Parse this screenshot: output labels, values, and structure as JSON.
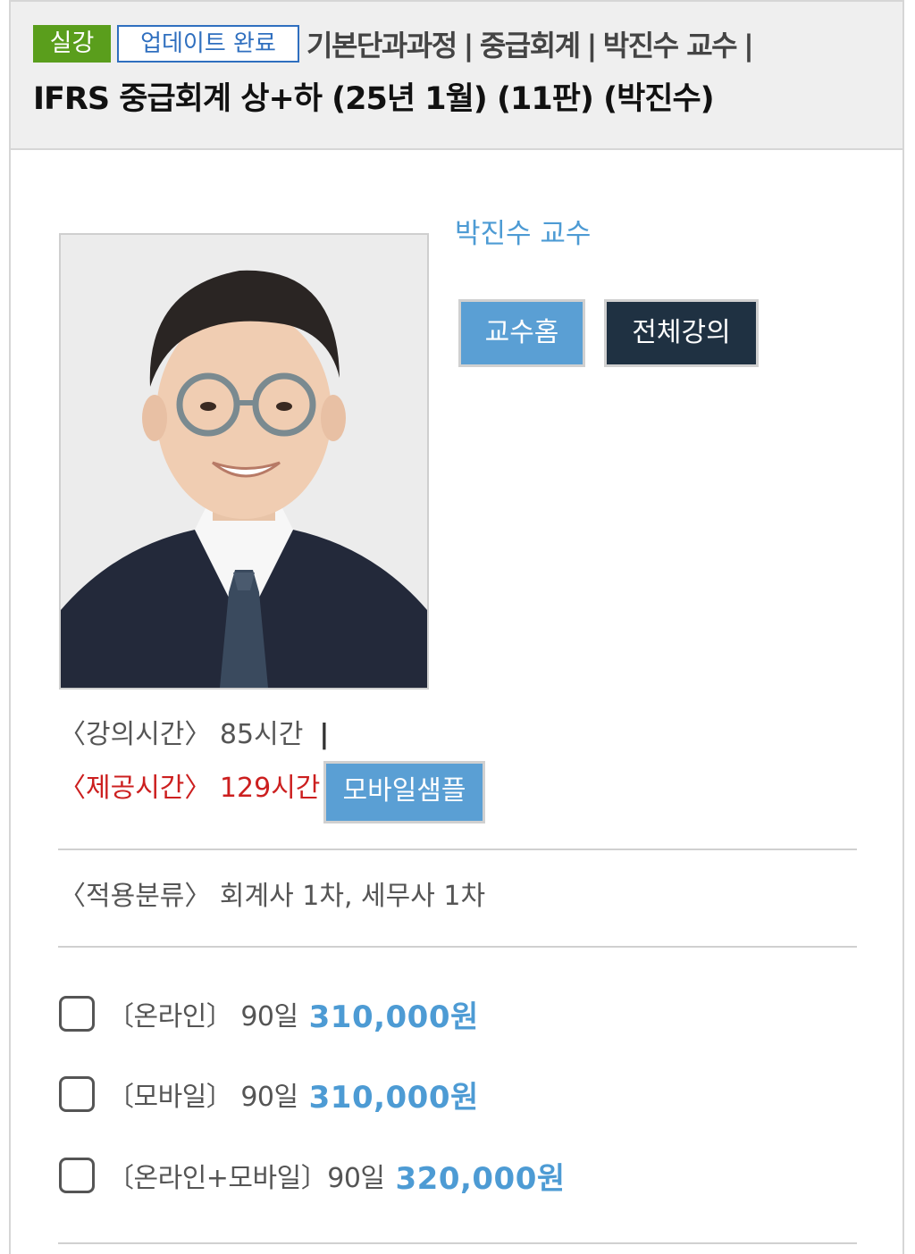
{
  "header": {
    "tag_live": "실강",
    "tag_update": "업데이트 완료",
    "breadcrumb": [
      "기본단과과정",
      "중급회계",
      "박진수 교수"
    ],
    "separator": "|",
    "title": "IFRS 중급회계 상+하 (25년 1월) (11판) (박진수)"
  },
  "professor": {
    "name": "박진수 교수",
    "home_button": "교수홈",
    "all_lectures_button": "전체강의"
  },
  "info": {
    "lecture_time": "〈강의시간〉 85시간",
    "lecture_time_sep": "|",
    "provide_time": "〈제공시간〉 129시간",
    "mobile_sample_button": "모바일샘플",
    "category": "〈적용분류〉 회계사 1차, 세무사 1차"
  },
  "options": [
    {
      "label": "〔온라인〕 90일",
      "price": "310,000원",
      "checked": false
    },
    {
      "label": "〔모바일〕 90일",
      "price": "310,000원",
      "checked": false
    },
    {
      "label": "〔온라인+모바일〕90일",
      "price": "320,000원",
      "checked": false
    }
  ],
  "colors": {
    "accent_blue": "#4d9bd4",
    "button_blue": "#5a9fd4",
    "button_dark": "#1f3142",
    "live_tag_green": "#5a9e1c",
    "highlight_red": "#cc1f1f"
  }
}
